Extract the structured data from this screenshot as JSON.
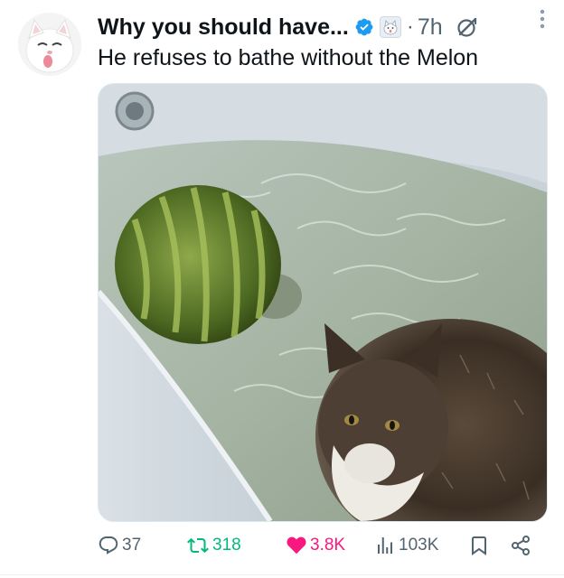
{
  "author": {
    "display_name": "Why you should have...",
    "avatar_icon": "white-cat-avatar",
    "verified_icon": "verified-badge-icon",
    "affiliate_icon": "affiliate-badge-icon",
    "separator": "·",
    "time": "7h"
  },
  "icons": {
    "grok": "grok-icon",
    "more": "more-vertical-icon",
    "reply": "reply-icon",
    "retweet": "retweet-icon",
    "like": "heart-icon",
    "views": "views-icon",
    "bookmark": "bookmark-icon",
    "share": "share-icon"
  },
  "tweet": {
    "text": "He refuses to bathe without the Melon",
    "media_icon": "photo-cat-watermelon-bathtub"
  },
  "stats": {
    "replies": "37",
    "retweets": "318",
    "likes": "3.8K",
    "views": "103K"
  },
  "colors": {
    "verified": "#1d9bf0",
    "retweet": "#00ba7c",
    "like": "#f91880",
    "muted": "#536471",
    "text": "#0f1419"
  }
}
